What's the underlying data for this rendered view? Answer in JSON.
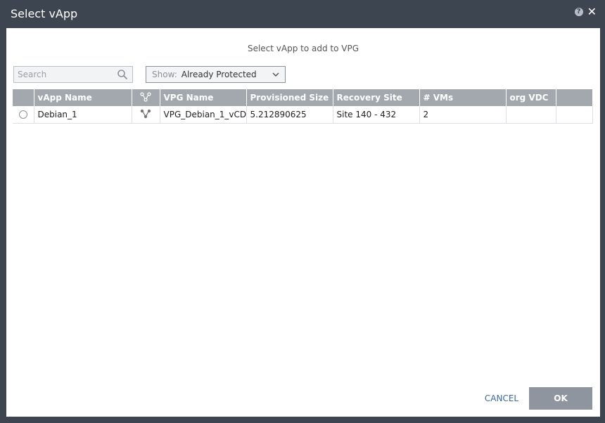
{
  "dialog": {
    "title": "Select vApp",
    "subtitle": "Select vApp to add to VPG"
  },
  "filters": {
    "search_placeholder": "Search",
    "show_label": "Show:",
    "show_value": "Already Protected"
  },
  "table": {
    "columns": [
      "vApp Name",
      "",
      "VPG Name",
      "Provisioned Size",
      "Recovery Site",
      "# VMs",
      "org VDC",
      ""
    ],
    "rows": [
      {
        "vapp_name": "Debian_1",
        "vpg_name": "VPG_Debian_1_vCD",
        "provisioned_size": "5.212890625",
        "recovery_site": "Site 140 - 432",
        "vms": "2",
        "org_vdc": ""
      }
    ]
  },
  "footer": {
    "cancel_label": "CANCEL",
    "ok_label": "OK"
  },
  "icons": {
    "help": "help-icon",
    "close": "close-icon",
    "search": "search-icon",
    "chevron": "chevron-down-icon",
    "vpg": "network-share-icon"
  },
  "colors": {
    "titlebar": "#3d4550",
    "header_bg": "#a3a8ae",
    "ok_button": "#8e959e",
    "cancel_text": "#3c6a9e"
  }
}
